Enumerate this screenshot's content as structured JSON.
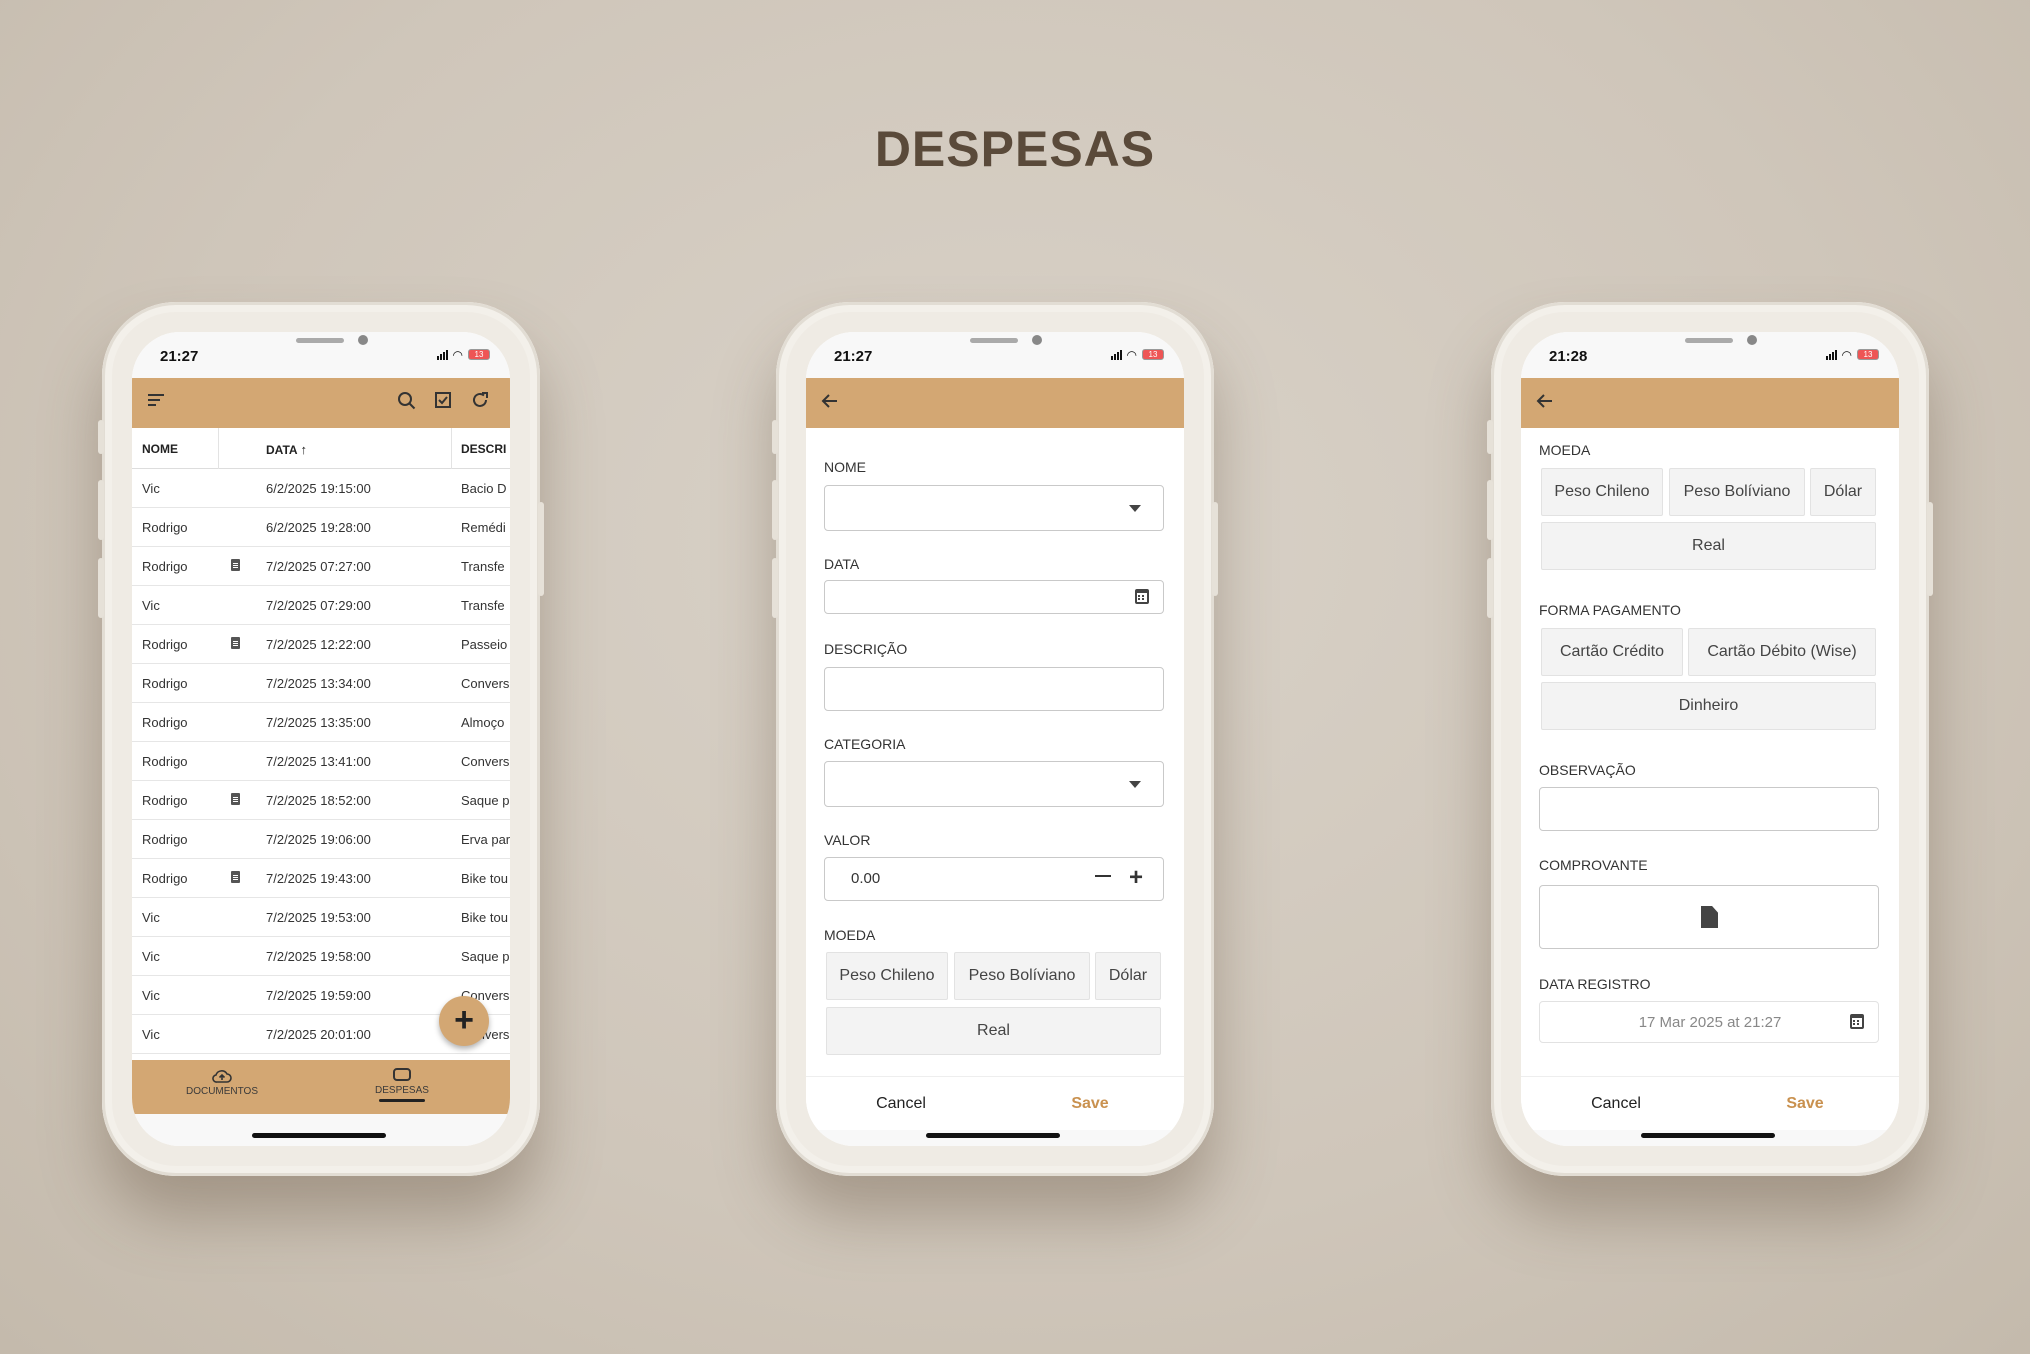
{
  "page_title": "DESPESAS",
  "status_bar": {
    "time1": "21:27",
    "time2": "21:27",
    "time3": "21:28",
    "battery": "13"
  },
  "list": {
    "columns": [
      "NOME",
      "DATA",
      "DESCRI"
    ],
    "rows": [
      {
        "nome": "Vic",
        "data": "6/2/2025 19:15:00",
        "descricao": "Bacio D",
        "doc": false
      },
      {
        "nome": "Rodrigo",
        "data": "6/2/2025 19:28:00",
        "descricao": "Remédi",
        "doc": false
      },
      {
        "nome": "Rodrigo",
        "data": "7/2/2025 07:27:00",
        "descricao": "Transfe",
        "doc": true
      },
      {
        "nome": "Vic",
        "data": "7/2/2025 07:29:00",
        "descricao": "Transfe",
        "doc": false
      },
      {
        "nome": "Rodrigo",
        "data": "7/2/2025 12:22:00",
        "descricao": "Passeio",
        "doc": true
      },
      {
        "nome": "Rodrigo",
        "data": "7/2/2025 13:34:00",
        "descricao": "Convers",
        "doc": false
      },
      {
        "nome": "Rodrigo",
        "data": "7/2/2025 13:35:00",
        "descricao": "Almoço",
        "doc": false
      },
      {
        "nome": "Rodrigo",
        "data": "7/2/2025 13:41:00",
        "descricao": "Convers",
        "doc": false
      },
      {
        "nome": "Rodrigo",
        "data": "7/2/2025 18:52:00",
        "descricao": "Saque p",
        "doc": true
      },
      {
        "nome": "Rodrigo",
        "data": "7/2/2025 19:06:00",
        "descricao": "Erva par",
        "doc": false
      },
      {
        "nome": "Rodrigo",
        "data": "7/2/2025 19:43:00",
        "descricao": "Bike tou",
        "doc": true
      },
      {
        "nome": "Vic",
        "data": "7/2/2025 19:53:00",
        "descricao": "Bike tou",
        "doc": false
      },
      {
        "nome": "Vic",
        "data": "7/2/2025 19:58:00",
        "descricao": "Saque p",
        "doc": false
      },
      {
        "nome": "Vic",
        "data": "7/2/2025 19:59:00",
        "descricao": "Convers",
        "doc": false
      },
      {
        "nome": "Vic",
        "data": "7/2/2025 20:01:00",
        "descricao": "Convers",
        "doc": false
      }
    ],
    "fab": "+",
    "bottom_nav": [
      {
        "label": "DOCUMENTOS",
        "active": false
      },
      {
        "label": "DESPESAS",
        "active": true
      }
    ]
  },
  "form": {
    "labels": {
      "nome": "NOME",
      "data": "DATA",
      "descricao": "DESCRIÇÃO",
      "categoria": "CATEGORIA",
      "valor": "VALOR",
      "moeda": "MOEDA"
    },
    "valor_value": "0.00",
    "moeda_options": [
      "Peso Chileno",
      "Peso Bolíviano",
      "Dólar",
      "Real"
    ],
    "cancel": "Cancel",
    "save": "Save"
  },
  "form2": {
    "labels": {
      "moeda": "MOEDA",
      "forma_pagamento": "FORMA PAGAMENTO",
      "observacao": "OBSERVAÇÃO",
      "comprovante": "COMPROVANTE",
      "data_registro": "DATA REGISTRO"
    },
    "moeda_options": [
      "Peso Chileno",
      "Peso Bolíviano",
      "Dólar",
      "Real"
    ],
    "pagamento_options": [
      "Cartão Crédito",
      "Cartão Débito (Wise)",
      "Dinheiro"
    ],
    "data_registro_value": "17 Mar 2025 at 21:27",
    "cancel": "Cancel",
    "save": "Save"
  },
  "colors": {
    "accent": "#d3a773",
    "save": "#c9914f",
    "title": "#5a4a3a"
  }
}
